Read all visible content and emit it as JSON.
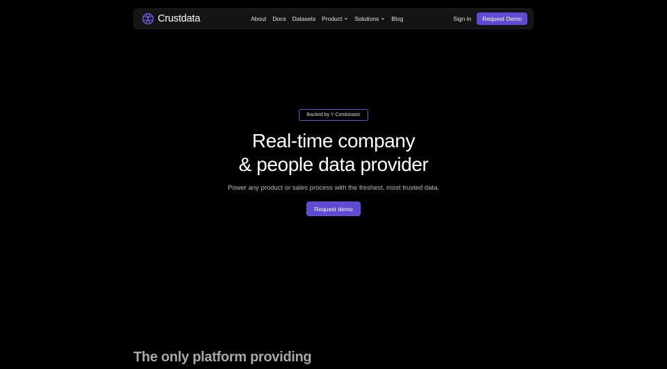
{
  "brand": {
    "name": "Crustdata",
    "logo_icon": "globe-logo-icon",
    "accent": "#5d4bd6"
  },
  "nav": {
    "links": [
      {
        "label": "About",
        "dropdown": false
      },
      {
        "label": "Docs",
        "dropdown": false
      },
      {
        "label": "Datasets",
        "dropdown": false
      },
      {
        "label": "Product",
        "dropdown": true
      },
      {
        "label": "Solutions",
        "dropdown": true
      },
      {
        "label": "Blog",
        "dropdown": false
      }
    ],
    "signin": "Sign in",
    "cta": "Request Demo"
  },
  "hero": {
    "badge": "Backed by Y Combinator",
    "title_line1": "Real-time company",
    "title_line2": "& people data provider",
    "subtitle": "Power any product or sales process with the freshest, most trusted data.",
    "cta": "Request demo"
  },
  "section": {
    "title": "The only platform providing"
  },
  "colors": {
    "background": "#000000",
    "navbar": "#141414",
    "button": "#5d4bd6",
    "badge_border": "#6656d8"
  }
}
